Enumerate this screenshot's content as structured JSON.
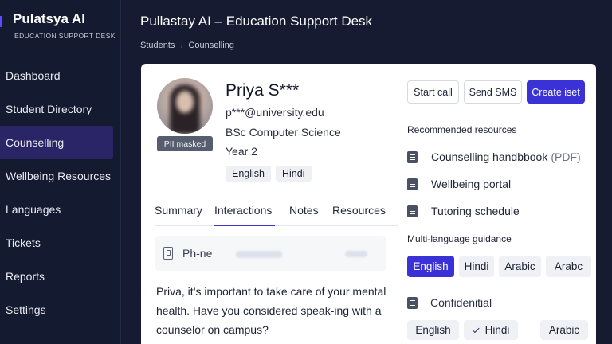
{
  "brand": {
    "title": "Pulatsya AI",
    "subtitle": "EDUCATION SUPPORT DESK"
  },
  "nav": [
    {
      "label": "Dashboard"
    },
    {
      "label": "Student Directory"
    },
    {
      "label": "Counselling",
      "active": true
    },
    {
      "label": "Wellbeing Resources"
    },
    {
      "label": "Languages"
    },
    {
      "label": "Tickets"
    },
    {
      "label": "Reports"
    },
    {
      "label": "Settings"
    }
  ],
  "header": {
    "title": "Pullastay AI – Education Support Desk",
    "breadcrumb": [
      "Students",
      "Counselling"
    ]
  },
  "student": {
    "name": "Priya S***",
    "email": "p***@university.edu",
    "program": "BSc Computer Science",
    "year": "Year 2",
    "pii_badge": "PII masked",
    "languages": [
      "English",
      "Hindi"
    ]
  },
  "tabs": [
    {
      "label": "Summary"
    },
    {
      "label": "Interactions",
      "active": true
    },
    {
      "label": "Notes"
    },
    {
      "label": "Resources"
    }
  ],
  "interaction": {
    "phone_label": "Ph-ne",
    "message": "Priva, it’s important to take care of your mental health. Have you considered speak-ing with a counselor on campus?"
  },
  "actions": {
    "start_call": "Start call",
    "send_sms": "Send SMS",
    "create": "Create iset"
  },
  "resources": {
    "title": "Recommended resources",
    "items": [
      {
        "label": "Counselling handbbook",
        "suffix": "(PDF)",
        "icon": "document-icon"
      },
      {
        "label": "Wellbeing portal",
        "icon": "document-icon"
      },
      {
        "label": "Tutoring schedule",
        "icon": "calendar-icon"
      }
    ]
  },
  "guidance": {
    "title": "Multi-language guidance",
    "languages": [
      "English",
      "Hindi",
      "Arabic",
      "Arabc"
    ],
    "active": "English"
  },
  "confidential": {
    "label": "Confidenitial",
    "languages": [
      "English",
      "Hindi",
      "Arabic"
    ],
    "checked": "Hindi"
  },
  "colors": {
    "accent": "#3a31d6",
    "sidebar_active": "#2a2566",
    "background": "#161b31"
  }
}
